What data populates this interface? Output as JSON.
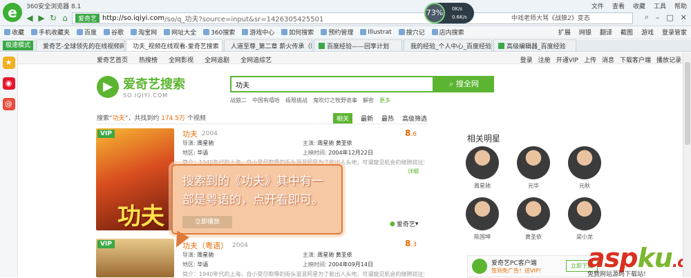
{
  "browser": {
    "app_title": "360安全浏览器 8.1",
    "site_badge": "爱奇艺",
    "url_host": "http://so.iqiyi.com",
    "url_path": "/so/q_功夫?source=input&sr=1426305425501",
    "search_engine_text": "中戏老师大骂《战狼2》变态",
    "top_menu": [
      "文件",
      "查看",
      "收藏",
      "工具",
      "帮助"
    ],
    "speed_pct": "73%",
    "speed_up": "0K/s",
    "speed_down": "0.6K/s"
  },
  "bookmarks": [
    "收藏",
    "手机收藏夹",
    "百度",
    "谷歌",
    "淘宝网",
    "网址大全",
    "360搜索",
    "游戏中心",
    "如何搜索",
    "预约管理",
    "Illustrat",
    "搜穴记",
    "店内搜索"
  ],
  "bookmarks_right": [
    "扩展",
    "网银",
    "翻译",
    "截图",
    "游戏",
    "登录管家"
  ],
  "tabs": {
    "speed_mode": "极速模式",
    "items": [
      "爱奇艺-全球领先的在线视频网",
      "功夫_视频在线观看-爱奇艺搜索",
      "人道至尊_第二章 薪火传承（新）",
      "百度经验——回享计划",
      "我的经验_个人中心_百度经验",
      "高级编辑器_百度经验"
    ]
  },
  "iqiyi": {
    "nav": [
      "爱奇艺首页",
      "热搜榜",
      "全网影视",
      "全网追剧",
      "全网追综艺"
    ],
    "user": [
      "登录",
      "注册",
      "开通VIP",
      "上传",
      "消息",
      "下载客户端",
      "播放记录"
    ],
    "logo_title": "爱奇艺搜索",
    "logo_sub": "SO.IQIYI.COM",
    "search_value": "功夫",
    "search_button": "搜全网",
    "hot_words": [
      "战狼二",
      "中国有嘻哈",
      "极限挑战",
      "鬼吹灯之牧野诡事",
      "解密",
      "更多"
    ],
    "result_prefix": "搜索“",
    "result_query": "功夫",
    "result_mid": "”，共找到约 ",
    "result_count": "174.5万",
    "result_suffix": " 个视频",
    "sort": [
      "相关",
      "最新",
      "最热",
      "高级筛选"
    ]
  },
  "results": [
    {
      "vip": "VIP",
      "poster_title": "功夫",
      "title": "功夫",
      "year": "2004",
      "score_int": "8",
      "score_dec": ".6",
      "director_label": "导演:",
      "director": "周星驰",
      "cast_label": "主演:",
      "cast": "周星驰 黄圣依",
      "region_label": "地区:",
      "region": "华语",
      "date_label": "上映时间:",
      "date": "2004年12月22日",
      "desc": "简介：1940年代的上海，自小受尽欺辱的街头混混阿星为了能出人头地，可谓窥见机会的缝隙就往里钻，",
      "more": "详细",
      "play": "立即播放",
      "source": "爱奇艺"
    },
    {
      "vip": "VIP",
      "title": "功夫（粤语）",
      "year": "2004",
      "score_int": "8",
      "score_dec": ".3",
      "director_label": "导演:",
      "director": "周星驰",
      "cast_label": "主演:",
      "cast": "周星驰 黄圣依",
      "region_label": "地区:",
      "region": "华语",
      "date_label": "上映时间:",
      "date": "2004年09月14日",
      "desc": "简介：1940年代的上海，自小受尽欺辱的街头混混阿星为了能出人头地，可谓窥见机会的缝隙就往里钻，"
    }
  ],
  "callout": "搜索到的《功夫》其中有一部是粤语的，点开看即可。",
  "stars": {
    "title": "相关明星",
    "names": [
      "周星驰",
      "元华",
      "元秋",
      "陈国坤",
      "黄圣依",
      "梁小龙"
    ]
  },
  "client": {
    "title": "爱奇艺PC客户端",
    "sub": "签到免广告！送VIP！",
    "button": "立即下载"
  },
  "watermark": {
    "a": "asp",
    "k": "ku",
    "b": ".com",
    "sub": "免费网站源码下载站!"
  }
}
